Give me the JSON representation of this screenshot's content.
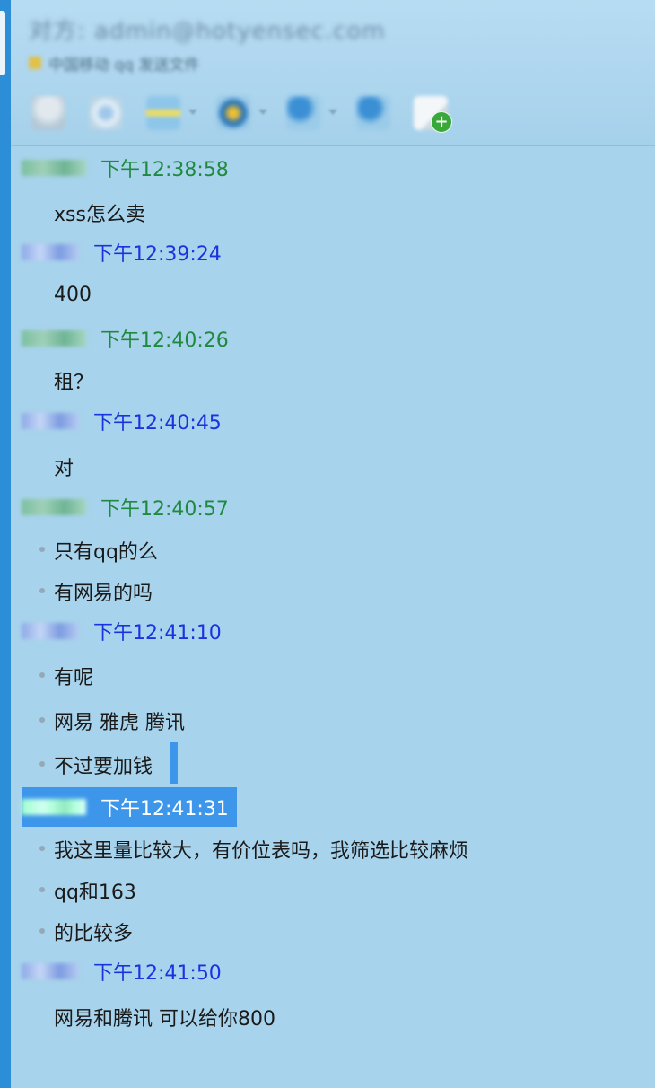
{
  "header": {
    "title": "对方: admin@hotyensec.com",
    "subtitle": "中国移动 qq 发送文件"
  },
  "toolbar": {
    "items": [
      {
        "icon": "microphone-icon",
        "has_arrow": false
      },
      {
        "icon": "camera-icon",
        "has_arrow": false
      },
      {
        "icon": "folder-icon",
        "has_arrow": true
      },
      {
        "icon": "globe-icon",
        "has_arrow": true
      },
      {
        "icon": "user-remove-icon",
        "has_arrow": true
      },
      {
        "icon": "user-add-icon",
        "has_arrow": false
      },
      {
        "icon": "note-add-icon",
        "has_arrow": false
      }
    ]
  },
  "chat": {
    "messages": [
      {
        "sender_color": "green",
        "time": "下午12:38:58",
        "lines": [
          "xss怎么卖"
        ],
        "bulleted": false
      },
      {
        "sender_color": "blue",
        "time": "下午12:39:24",
        "lines": [
          "400"
        ],
        "bulleted": false
      },
      {
        "sender_color": "green",
        "time": "下午12:40:26",
        "lines": [
          "租？"
        ],
        "bulleted": false
      },
      {
        "sender_color": "blue",
        "time": "下午12:40:45",
        "lines": [
          "对"
        ],
        "bulleted": false
      },
      {
        "sender_color": "green",
        "time": "下午12:40:57",
        "lines": [
          "只有qq的么",
          "有网易的吗"
        ],
        "bulleted": true
      },
      {
        "sender_color": "blue",
        "time": "下午12:41:10",
        "lines": [
          "有呢",
          "网易  雅虎  腾讯",
          "不过要加钱"
        ],
        "bulleted": true
      },
      {
        "sender_color": "green",
        "time": "下午12:41:31",
        "lines": [
          "我这里量比较大，有价位表吗，我筛选比较麻烦",
          "qq和163",
          "的比较多"
        ],
        "bulleted": true,
        "selected": true
      },
      {
        "sender_color": "blue",
        "time": "下午12:41:50",
        "lines": [
          "网易和腾讯  可以给你800"
        ],
        "bulleted": false
      }
    ]
  },
  "colors": {
    "background": "#a8d3ec",
    "sender_green": "#1f8a3e",
    "sender_blue": "#1a33e0",
    "selection": "#3d96ea"
  }
}
